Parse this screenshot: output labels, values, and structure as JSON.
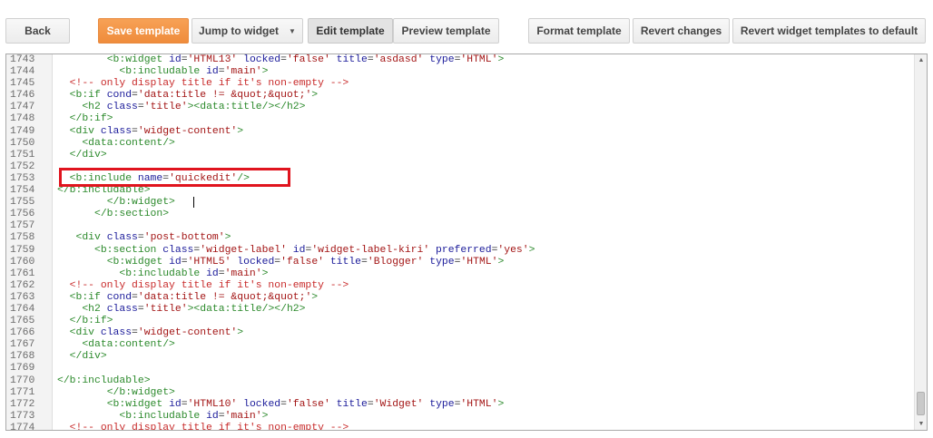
{
  "toolbar": {
    "back": "Back",
    "save": "Save template",
    "jump": "Jump to widget",
    "edit": "Edit template",
    "preview": "Preview template",
    "format": "Format template",
    "revert": "Revert changes",
    "revert_default": "Revert widget templates to default"
  },
  "icons": {
    "dropdown": "chevron-down-icon",
    "scroll_up": "arrow-up-icon",
    "scroll_down": "arrow-down-icon"
  },
  "colors": {
    "accent": "#f08d3f",
    "highlight": "#e0141e",
    "tag": "#2c8a2c",
    "attr": "#1b1b9a",
    "string": "#a31515",
    "comment": "#c82a2a"
  },
  "editor": {
    "lines": [
      {
        "n": "1743",
        "t": [
          [
            "p",
            "        "
          ],
          [
            "tag",
            "<b:widget"
          ],
          [
            "p",
            " "
          ],
          [
            "attr",
            "id"
          ],
          [
            "p",
            "="
          ],
          [
            "str",
            "'HTML13'"
          ],
          [
            "p",
            " "
          ],
          [
            "attr",
            "locked"
          ],
          [
            "p",
            "="
          ],
          [
            "str",
            "'false'"
          ],
          [
            "p",
            " "
          ],
          [
            "attr",
            "title"
          ],
          [
            "p",
            "="
          ],
          [
            "str",
            "'asdasd'"
          ],
          [
            "p",
            " "
          ],
          [
            "attr",
            "type"
          ],
          [
            "p",
            "="
          ],
          [
            "str",
            "'HTML'"
          ],
          [
            "tag",
            ">"
          ]
        ]
      },
      {
        "n": "1744",
        "t": [
          [
            "p",
            "          "
          ],
          [
            "tag",
            "<b:includable"
          ],
          [
            "p",
            " "
          ],
          [
            "attr",
            "id"
          ],
          [
            "p",
            "="
          ],
          [
            "str",
            "'main'"
          ],
          [
            "tag",
            ">"
          ]
        ]
      },
      {
        "n": "1745",
        "t": [
          [
            "p",
            "  "
          ],
          [
            "com",
            "<!-- only display title if it's non-empty -->"
          ]
        ]
      },
      {
        "n": "1746",
        "t": [
          [
            "p",
            "  "
          ],
          [
            "tag",
            "<b:if"
          ],
          [
            "p",
            " "
          ],
          [
            "attr",
            "cond"
          ],
          [
            "p",
            "="
          ],
          [
            "str",
            "'data:title != &quot;&quot;'"
          ],
          [
            "tag",
            ">"
          ]
        ]
      },
      {
        "n": "1747",
        "t": [
          [
            "p",
            "    "
          ],
          [
            "tag",
            "<h2"
          ],
          [
            "p",
            " "
          ],
          [
            "attr",
            "class"
          ],
          [
            "p",
            "="
          ],
          [
            "str",
            "'title'"
          ],
          [
            "tag",
            "><data:title/></h2>"
          ]
        ]
      },
      {
        "n": "1748",
        "t": [
          [
            "p",
            "  "
          ],
          [
            "tag",
            "</b:if>"
          ]
        ]
      },
      {
        "n": "1749",
        "t": [
          [
            "p",
            "  "
          ],
          [
            "tag",
            "<div"
          ],
          [
            "p",
            " "
          ],
          [
            "attr",
            "class"
          ],
          [
            "p",
            "="
          ],
          [
            "str",
            "'widget-content'"
          ],
          [
            "tag",
            ">"
          ]
        ]
      },
      {
        "n": "1750",
        "t": [
          [
            "p",
            "    "
          ],
          [
            "tag",
            "<data:content/>"
          ]
        ]
      },
      {
        "n": "1751",
        "t": [
          [
            "p",
            "  "
          ],
          [
            "tag",
            "</div>"
          ]
        ]
      },
      {
        "n": "1752",
        "t": []
      },
      {
        "n": "1753",
        "t": [
          [
            "p",
            "  "
          ],
          [
            "tag",
            "<b:include"
          ],
          [
            "p",
            " "
          ],
          [
            "attr",
            "name"
          ],
          [
            "p",
            "="
          ],
          [
            "str",
            "'quickedit'"
          ],
          [
            "tag",
            "/>"
          ]
        ]
      },
      {
        "n": "1754",
        "t": [
          [
            "tag",
            "</b:includable>"
          ]
        ]
      },
      {
        "n": "1755",
        "t": [
          [
            "p",
            "        "
          ],
          [
            "tag",
            "</b:widget>"
          ]
        ]
      },
      {
        "n": "1756",
        "t": [
          [
            "p",
            "      "
          ],
          [
            "tag",
            "</b:section>"
          ]
        ]
      },
      {
        "n": "1757",
        "t": []
      },
      {
        "n": "1758",
        "t": [
          [
            "p",
            "   "
          ],
          [
            "tag",
            "<div"
          ],
          [
            "p",
            " "
          ],
          [
            "attr",
            "class"
          ],
          [
            "p",
            "="
          ],
          [
            "str",
            "'post-bottom'"
          ],
          [
            "tag",
            ">"
          ]
        ]
      },
      {
        "n": "1759",
        "t": [
          [
            "p",
            "      "
          ],
          [
            "tag",
            "<b:section"
          ],
          [
            "p",
            " "
          ],
          [
            "attr",
            "class"
          ],
          [
            "p",
            "="
          ],
          [
            "str",
            "'widget-label'"
          ],
          [
            "p",
            " "
          ],
          [
            "attr",
            "id"
          ],
          [
            "p",
            "="
          ],
          [
            "str",
            "'widget-label-kiri'"
          ],
          [
            "p",
            " "
          ],
          [
            "attr",
            "preferred"
          ],
          [
            "p",
            "="
          ],
          [
            "str",
            "'yes'"
          ],
          [
            "tag",
            ">"
          ]
        ]
      },
      {
        "n": "1760",
        "t": [
          [
            "p",
            "        "
          ],
          [
            "tag",
            "<b:widget"
          ],
          [
            "p",
            " "
          ],
          [
            "attr",
            "id"
          ],
          [
            "p",
            "="
          ],
          [
            "str",
            "'HTML5'"
          ],
          [
            "p",
            " "
          ],
          [
            "attr",
            "locked"
          ],
          [
            "p",
            "="
          ],
          [
            "str",
            "'false'"
          ],
          [
            "p",
            " "
          ],
          [
            "attr",
            "title"
          ],
          [
            "p",
            "="
          ],
          [
            "str",
            "'Blogger'"
          ],
          [
            "p",
            " "
          ],
          [
            "attr",
            "type"
          ],
          [
            "p",
            "="
          ],
          [
            "str",
            "'HTML'"
          ],
          [
            "tag",
            ">"
          ]
        ]
      },
      {
        "n": "1761",
        "t": [
          [
            "p",
            "          "
          ],
          [
            "tag",
            "<b:includable"
          ],
          [
            "p",
            " "
          ],
          [
            "attr",
            "id"
          ],
          [
            "p",
            "="
          ],
          [
            "str",
            "'main'"
          ],
          [
            "tag",
            ">"
          ]
        ]
      },
      {
        "n": "1762",
        "t": [
          [
            "p",
            "  "
          ],
          [
            "com",
            "<!-- only display title if it's non-empty -->"
          ]
        ]
      },
      {
        "n": "1763",
        "t": [
          [
            "p",
            "  "
          ],
          [
            "tag",
            "<b:if"
          ],
          [
            "p",
            " "
          ],
          [
            "attr",
            "cond"
          ],
          [
            "p",
            "="
          ],
          [
            "str",
            "'data:title != &quot;&quot;'"
          ],
          [
            "tag",
            ">"
          ]
        ]
      },
      {
        "n": "1764",
        "t": [
          [
            "p",
            "    "
          ],
          [
            "tag",
            "<h2"
          ],
          [
            "p",
            " "
          ],
          [
            "attr",
            "class"
          ],
          [
            "p",
            "="
          ],
          [
            "str",
            "'title'"
          ],
          [
            "tag",
            "><data:title/></h2>"
          ]
        ]
      },
      {
        "n": "1765",
        "t": [
          [
            "p",
            "  "
          ],
          [
            "tag",
            "</b:if>"
          ]
        ]
      },
      {
        "n": "1766",
        "t": [
          [
            "p",
            "  "
          ],
          [
            "tag",
            "<div"
          ],
          [
            "p",
            " "
          ],
          [
            "attr",
            "class"
          ],
          [
            "p",
            "="
          ],
          [
            "str",
            "'widget-content'"
          ],
          [
            "tag",
            ">"
          ]
        ]
      },
      {
        "n": "1767",
        "t": [
          [
            "p",
            "    "
          ],
          [
            "tag",
            "<data:content/>"
          ]
        ]
      },
      {
        "n": "1768",
        "t": [
          [
            "p",
            "  "
          ],
          [
            "tag",
            "</div>"
          ]
        ]
      },
      {
        "n": "1769",
        "t": []
      },
      {
        "n": "1770",
        "t": [
          [
            "tag",
            "</b:includable>"
          ]
        ]
      },
      {
        "n": "1771",
        "t": [
          [
            "p",
            "        "
          ],
          [
            "tag",
            "</b:widget>"
          ]
        ]
      },
      {
        "n": "1772",
        "t": [
          [
            "p",
            "        "
          ],
          [
            "tag",
            "<b:widget"
          ],
          [
            "p",
            " "
          ],
          [
            "attr",
            "id"
          ],
          [
            "p",
            "="
          ],
          [
            "str",
            "'HTML10'"
          ],
          [
            "p",
            " "
          ],
          [
            "attr",
            "locked"
          ],
          [
            "p",
            "="
          ],
          [
            "str",
            "'false'"
          ],
          [
            "p",
            " "
          ],
          [
            "attr",
            "title"
          ],
          [
            "p",
            "="
          ],
          [
            "str",
            "'Widget'"
          ],
          [
            "p",
            " "
          ],
          [
            "attr",
            "type"
          ],
          [
            "p",
            "="
          ],
          [
            "str",
            "'HTML'"
          ],
          [
            "tag",
            ">"
          ]
        ]
      },
      {
        "n": "1773",
        "t": [
          [
            "p",
            "          "
          ],
          [
            "tag",
            "<b:includable"
          ],
          [
            "p",
            " "
          ],
          [
            "attr",
            "id"
          ],
          [
            "p",
            "="
          ],
          [
            "str",
            "'main'"
          ],
          [
            "tag",
            ">"
          ]
        ]
      },
      {
        "n": "1774",
        "t": [
          [
            "p",
            "  "
          ],
          [
            "com",
            "<!-- only display title if it's non-empty -->"
          ]
        ]
      }
    ]
  }
}
